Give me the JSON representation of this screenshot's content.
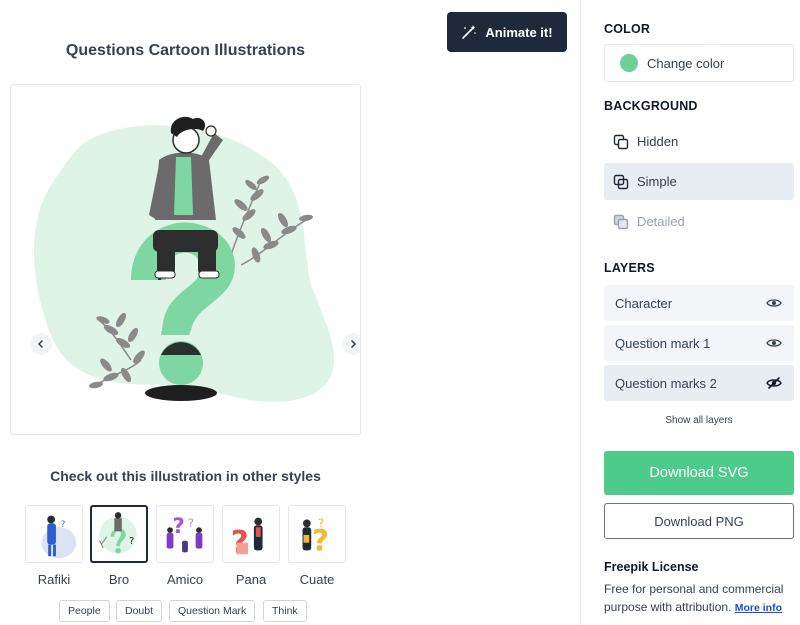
{
  "header": {
    "title": "Questions Cartoon Illustrations",
    "animate_label": "Animate it!"
  },
  "styles": {
    "heading": "Check out this illustration in other styles",
    "items": [
      {
        "label": "Rafiki"
      },
      {
        "label": "Bro",
        "active": true
      },
      {
        "label": "Amico"
      },
      {
        "label": "Pana"
      },
      {
        "label": "Cuate"
      }
    ]
  },
  "tags": [
    "People",
    "Doubt",
    "Question Mark",
    "Think"
  ],
  "sidebar": {
    "color_title": "COLOR",
    "change_color_label": "Change color",
    "accent_color": "#6fcf97",
    "background_title": "BACKGROUND",
    "background_options": [
      {
        "label": "Hidden",
        "state": "default"
      },
      {
        "label": "Simple",
        "state": "selected"
      },
      {
        "label": "Detailed",
        "state": "disabled"
      }
    ],
    "layers_title": "LAYERS",
    "layers": [
      {
        "label": "Character",
        "visible": true
      },
      {
        "label": "Question mark 1",
        "visible": true
      },
      {
        "label": "Question marks 2",
        "visible": false
      }
    ],
    "show_all_layers": "Show all layers",
    "download_svg": "Download SVG",
    "download_png": "Download PNG",
    "license_title": "Freepik License",
    "license_text": "Free for personal and commercial purpose with attribution.",
    "license_link": "More info"
  },
  "colors": {
    "brand_green": "#4ccb8a",
    "dark_button": "#1e2a3b"
  }
}
